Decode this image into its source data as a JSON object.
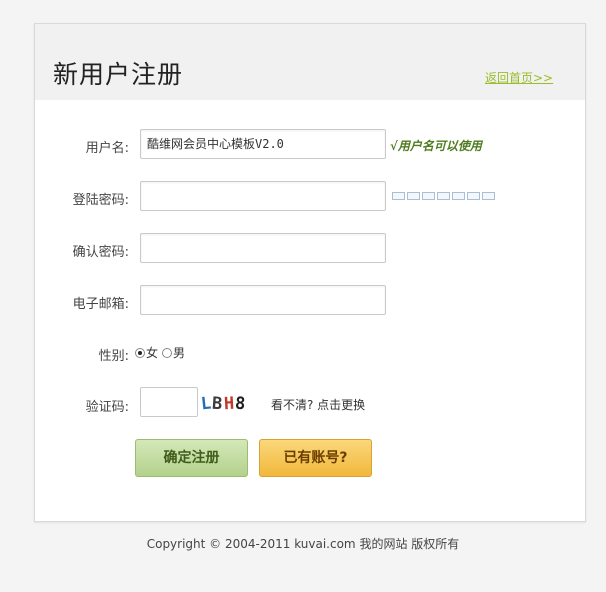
{
  "header": {
    "title": "新用户注册",
    "home_link": "返回首页>>"
  },
  "form": {
    "username_label": "用户名:",
    "username_value": "酷维网会员中心模板V2.0",
    "username_ok": "√用户名可以使用",
    "password_label": "登陆密码:",
    "password_value": "",
    "password_strength_segments": 7,
    "confirm_label": "确认密码:",
    "confirm_value": "",
    "email_label": "电子邮箱:",
    "email_value": "",
    "gender_label": "性别:",
    "gender_options": [
      "女",
      "男"
    ],
    "gender_selected": "女",
    "captcha_label": "验证码:",
    "captcha_value": "",
    "captcha_text": "LBH8",
    "captcha_refresh": "看不清? 点击更换"
  },
  "buttons": {
    "register": "确定注册",
    "has_account": "已有账号?"
  },
  "footer": {
    "copyright": "Copyright © 2004-2011 kuvai.com 我的网站 版权所有"
  },
  "colors": {
    "accent_green": "#9bbd2a",
    "ok_text": "#4f7c1e",
    "register_button": "#b3d18c",
    "login_button": "#f1b83b"
  }
}
